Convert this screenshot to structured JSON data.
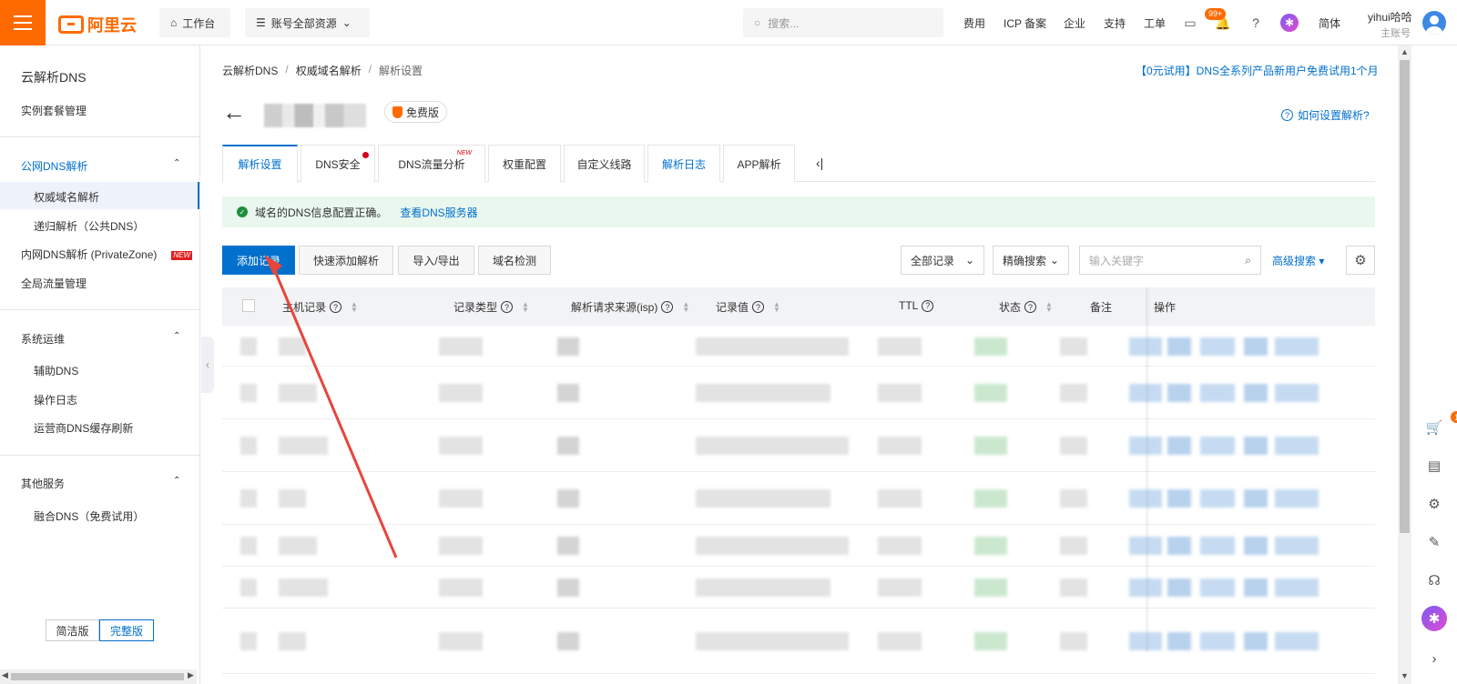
{
  "topbar": {
    "logo_text": "阿里云",
    "workbench": "工作台",
    "resources": "账号全部资源",
    "search_placeholder": "搜索...",
    "links": [
      "费用",
      "ICP 备案",
      "企业",
      "支持",
      "工单"
    ],
    "notif_badge": "99+",
    "lang": "简体",
    "user_name": "yihui哈哈",
    "user_role": "主账号"
  },
  "sidebar": {
    "title": "云解析DNS",
    "instance": "实例套餐管理",
    "public_group": "公网DNS解析",
    "authority": "权威域名解析",
    "recursive": "递归解析（公共DNS）",
    "private_zone": "内网DNS解析 (PrivateZone)",
    "new_tag": "NEW",
    "gtm": "全局流量管理",
    "ops_group": "系统运维",
    "aux_dns": "辅助DNS",
    "op_log": "操作日志",
    "isp_refresh": "运营商DNS缓存刷新",
    "other_group": "其他服务",
    "fusion": "融合DNS（免费试用）",
    "mode_simple": "简洁版",
    "mode_full": "完整版"
  },
  "main": {
    "breadcrumb": [
      "云解析DNS",
      "权威域名解析",
      "解析设置"
    ],
    "promo": "【0元试用】DNS全系列产品新用户免费试用1个月",
    "edition_badge": "免费版",
    "help_link": "如何设置解析?",
    "tabs": [
      "解析设置",
      "DNS安全",
      "DNS流量分析",
      "权重配置",
      "自定义线路",
      "解析日志",
      "APP解析"
    ],
    "tab_new": "NEW",
    "alert_text": "域名的DNS信息配置正确。",
    "alert_link": "查看DNS服务器",
    "buttons": {
      "add_record": "添加记录",
      "quick_add": "快速添加解析",
      "import_export": "导入/导出",
      "domain_check": "域名检测"
    },
    "filter_all": "全部记录",
    "filter_exact": "精确搜索",
    "keyword_placeholder": "输入关键字",
    "advanced_search": "高级搜索",
    "columns": [
      "主机记录",
      "记录类型",
      "解析请求来源(isp)",
      "记录值",
      "TTL",
      "状态",
      "备注",
      "操作"
    ]
  },
  "colors": {
    "brand": "#ff6a00",
    "primary": "#0070cc",
    "success_bg": "#e9f7ef",
    "annotation_arrow": "#e8453c"
  }
}
